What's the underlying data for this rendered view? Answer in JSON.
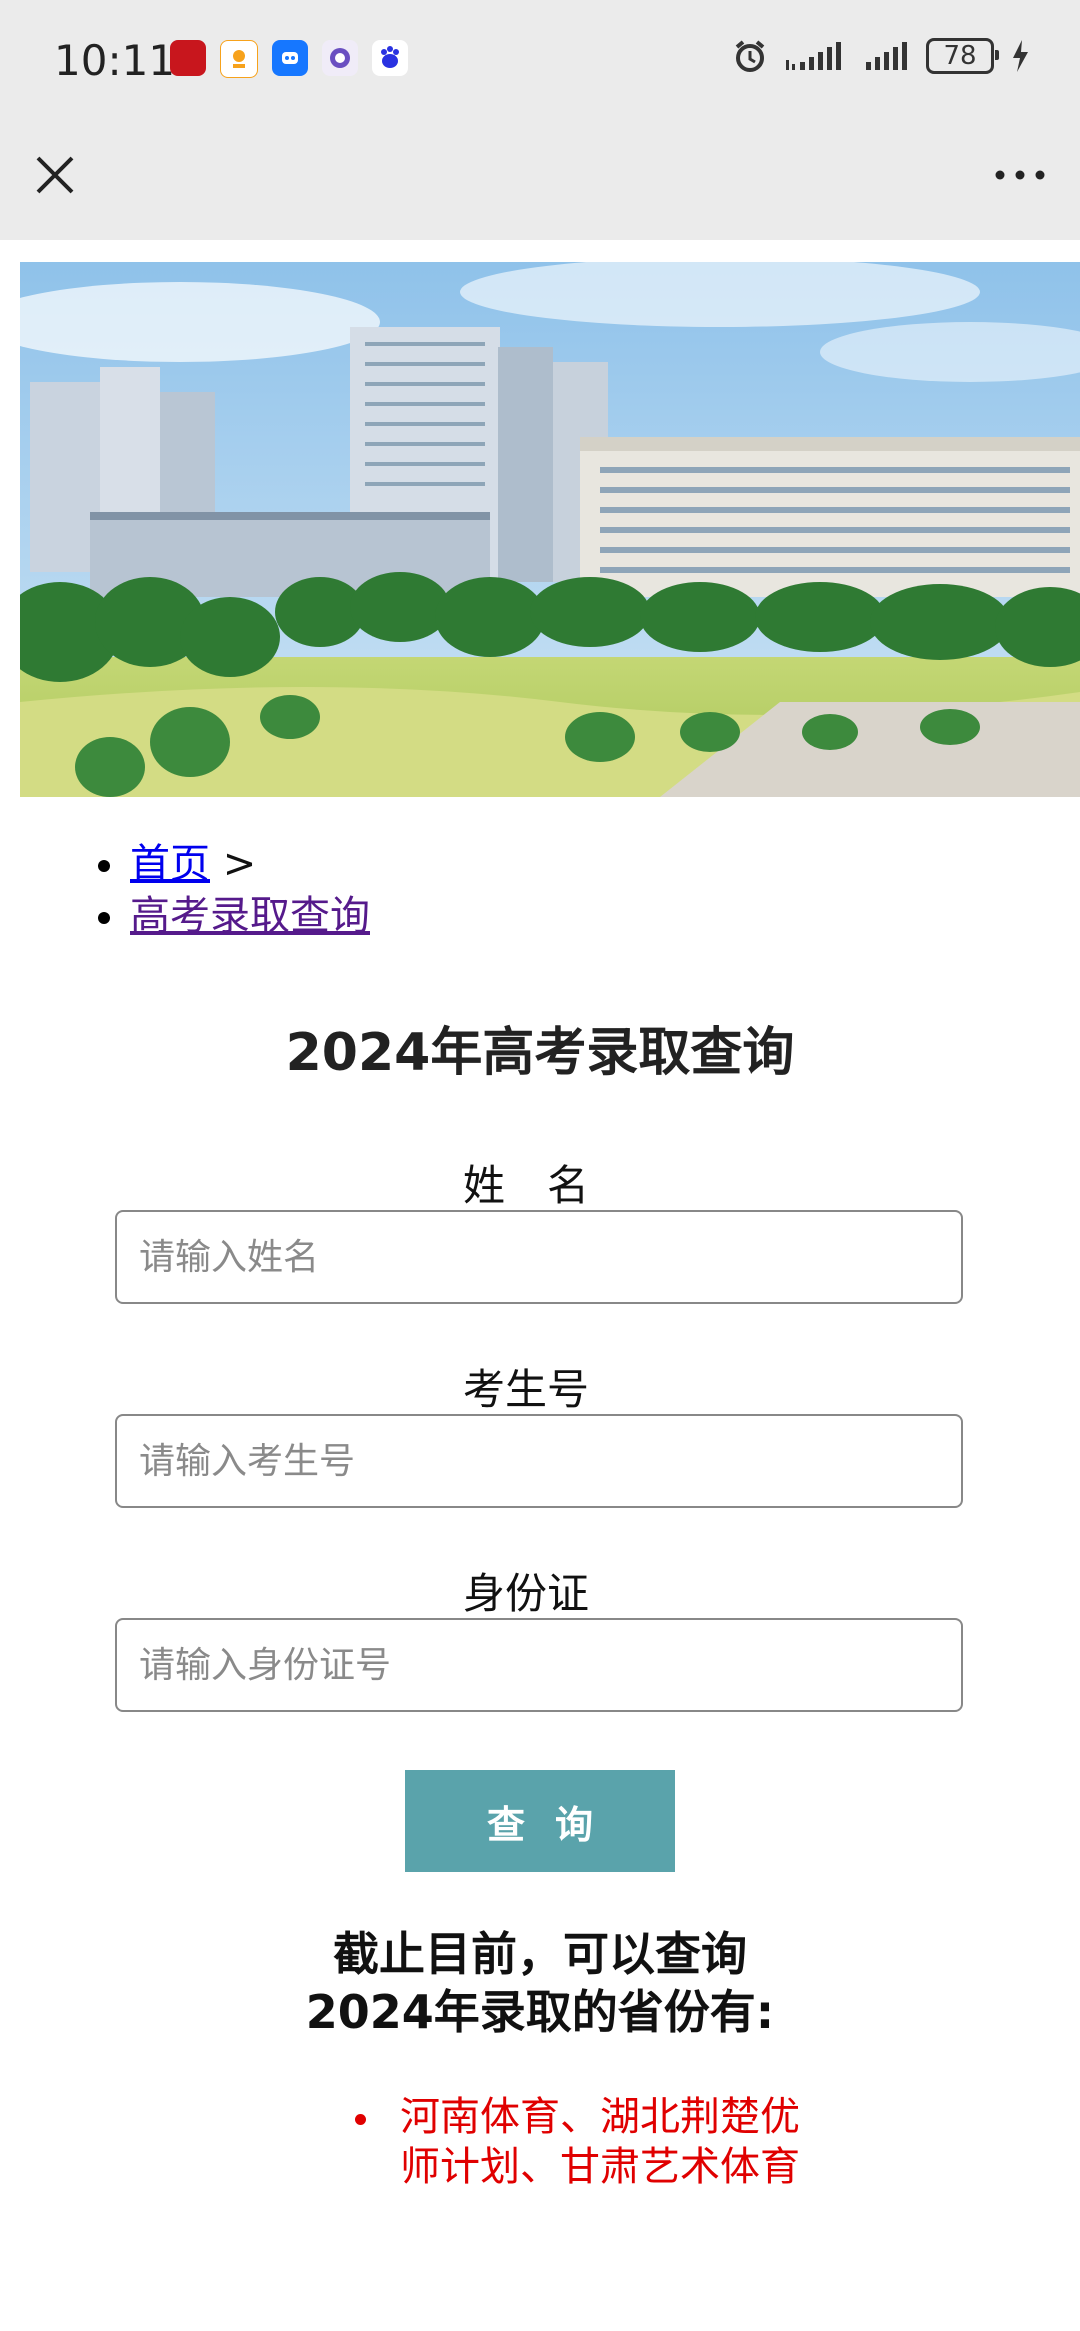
{
  "status_bar": {
    "time": "10:11",
    "battery": "78",
    "app_icons": [
      "xuexi-icon",
      "orange-app-icon",
      "blue-app-icon",
      "purple-app-icon",
      "baidu-icon"
    ]
  },
  "nav": {
    "close_icon": "close-icon",
    "more_icon": "more-icon"
  },
  "breadcrumb": {
    "home": "首页",
    "separator": ">",
    "current": "高考录取查询"
  },
  "page_title": "2024年高考录取查询",
  "form": {
    "name_label": "姓　名",
    "name_placeholder": "请输入姓名",
    "exam_label": "考生号",
    "exam_placeholder": "请输入考生号",
    "id_label": "身份证",
    "id_placeholder": "请输入身份证号",
    "submit_label": "查询"
  },
  "notice": {
    "line1": "截止目前，可以查询",
    "line2": "2024年录取的省份有:",
    "provinces": "河南体育、湖北荆楚优师计划、甘肃艺术体育"
  },
  "colors": {
    "button": "#5aa3ab",
    "provinces": "#e00000",
    "bars": "#ebebeb"
  }
}
